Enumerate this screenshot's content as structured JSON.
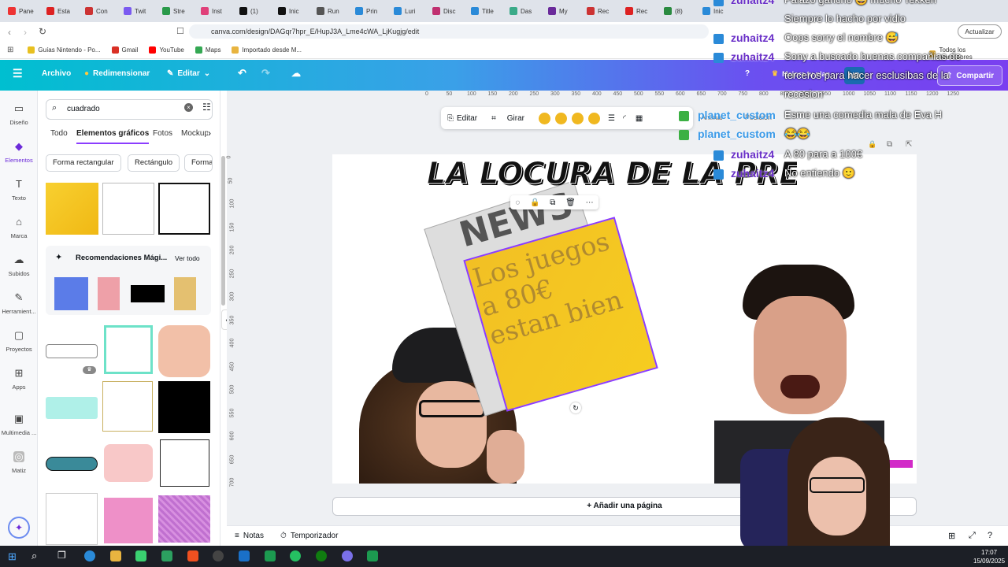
{
  "browser": {
    "tabs": [
      "Pane",
      "Esta",
      "Con",
      "Twit",
      "Stre",
      "Inst",
      "(1)",
      "Inic",
      "Run",
      "Prin",
      "Luri",
      "Disc",
      "Title",
      "Das",
      "My",
      "Rec",
      "Rec",
      "(8)",
      "Inic"
    ],
    "url": "canva.com/design/DAGqr7hpr_E/HupJ3A_Lme4cWA_LjKugjg/edit",
    "update_label": "Actualizar",
    "bookmarks": [
      "Guías Nintendo - Po...",
      "Gmail",
      "YouTube",
      "Maps",
      "Importado desde M..."
    ],
    "all_bookmarks": "Todos los marcadores"
  },
  "canva_header": {
    "file": "Archivo",
    "resize": "Redimensionar",
    "edit": "Editar",
    "upgrade": "Mejora tu plan",
    "avatar_initials": "ND",
    "share": "Compartir"
  },
  "rail": [
    "Diseño",
    "Elementos",
    "Texto",
    "Marca",
    "Subidos",
    "Herramient...",
    "Proyectos",
    "Apps",
    "Multimedia ...",
    "Matiz"
  ],
  "panel": {
    "search_value": "cuadrado",
    "tabs": [
      "Todo",
      "Elementos gráficos",
      "Fotos",
      "Mockup"
    ],
    "chips": [
      "Forma rectangular",
      "Rectángulo",
      "Forma"
    ],
    "magic_title": "Recomendaciones Mági...",
    "see_all": "Ver todo"
  },
  "ruler_h": [
    "0",
    "50",
    "100",
    "150",
    "200",
    "250",
    "300",
    "350",
    "400",
    "450",
    "500",
    "550",
    "600",
    "650",
    "700",
    "750",
    "800",
    "850",
    "900",
    "950",
    "1000",
    "1050",
    "1100",
    "1150",
    "1200",
    "1250"
  ],
  "ruler_v": [
    "0",
    "50",
    "100",
    "150",
    "200",
    "250",
    "300",
    "350",
    "400",
    "450",
    "500",
    "550",
    "600",
    "650",
    "700"
  ],
  "context_toolbar": {
    "edit": "Editar",
    "rotate": "Girar",
    "animate": "Animar",
    "position": "Posición"
  },
  "design": {
    "title": "LA LOCURA DE LA PRENSA",
    "news": "NEWS",
    "sticky_text": "Los juegos a 80€ estan bien"
  },
  "add_page": "+ Añadir una página",
  "bottom": {
    "notes": "Notas",
    "timer": "Temporizador"
  },
  "taskbar": {
    "time": "17:07",
    "date": "15/09/2025"
  },
  "chat": [
    {
      "user": "zuhaitz4",
      "msg": "Palazo gancho 😅 mucho Tekken"
    },
    {
      "user": "",
      "msg": "Siempre lo hacho por vidio"
    },
    {
      "user": "zuhaitz4",
      "msg": "Oops sorry el nombre 😅"
    },
    {
      "user": "zuhaitz4",
      "msg": "Sony a buscado buenas compañias de"
    },
    {
      "user": "",
      "msg": "terceros para hacer esclusibas de la"
    },
    {
      "user": "",
      "msg": "recesion"
    },
    {
      "user": "planet_custom",
      "msg": "Esme una comedia mala de Eva H"
    },
    {
      "user": "planet_custom",
      "msg": "😂😂"
    },
    {
      "user": "zuhaitz4",
      "msg": "A 80 para a 100€"
    },
    {
      "user": "zuhaitz4",
      "msg": "No entiendo 🙂"
    }
  ],
  "colors": {
    "accent": "#8b3dff",
    "sticky": "#f5c518"
  }
}
